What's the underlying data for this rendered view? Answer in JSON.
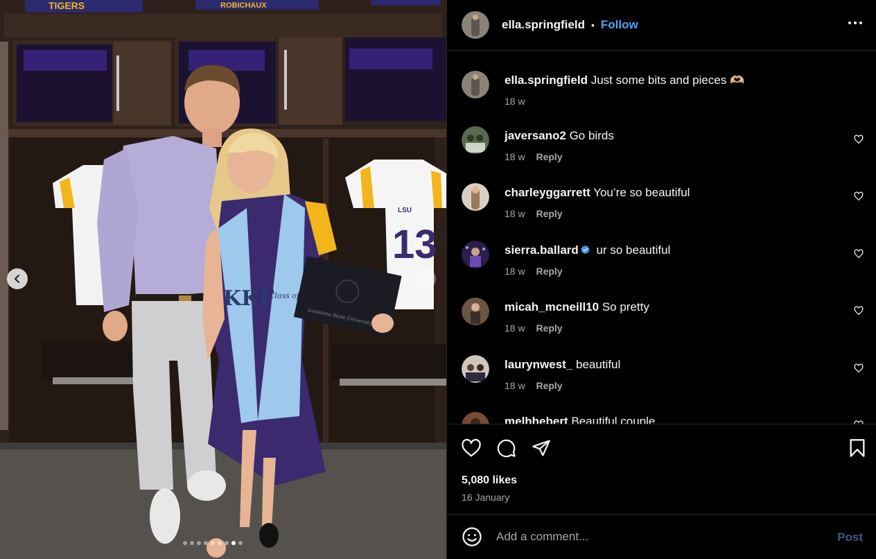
{
  "photo": {
    "carousel_total": 9,
    "carousel_active": 8,
    "jersey_number": "13",
    "jersey_brand": "LSU",
    "locker_signs": [
      "TIGERS",
      "ROBICHAUX"
    ],
    "sash_text": "ΚΚΓ",
    "stole_text": "Class of 2024",
    "diploma_text": "Louisiana State University"
  },
  "post": {
    "author": "ella.springfield",
    "separator": "•",
    "follow_label": "Follow",
    "caption": "Just some bits and pieces",
    "caption_emoji": "🫶🏼",
    "caption_time": "18 w"
  },
  "comments": [
    {
      "user": "javersano2",
      "text": "Go birds",
      "time": "18 w",
      "reply": "Reply",
      "verified": false
    },
    {
      "user": "charleyggarrett",
      "text": "You’re so beautiful",
      "time": "18 w",
      "reply": "Reply",
      "verified": false
    },
    {
      "user": "sierra.ballard",
      "text": "ur so beautiful",
      "time": "18 w",
      "reply": "Reply",
      "verified": true
    },
    {
      "user": "micah_mcneill10",
      "text": "So pretty",
      "time": "18 w",
      "reply": "Reply",
      "verified": false
    },
    {
      "user": "laurynwest_",
      "text": "beautiful",
      "time": "18 w",
      "reply": "Reply",
      "verified": false
    },
    {
      "user": "melhhebert",
      "text": "Beautiful couple",
      "time": "",
      "reply": "",
      "verified": false
    }
  ],
  "stats": {
    "likes": "5,080 likes",
    "date": "16 January"
  },
  "compose": {
    "placeholder": "Add a comment...",
    "post_label": "Post"
  },
  "colors": {
    "accent": "#4aa3f5",
    "background": "#000000",
    "muted_text": "#a8a8a8",
    "lsu_purple": "#3b2a6e",
    "lsu_gold": "#f2b51c"
  }
}
